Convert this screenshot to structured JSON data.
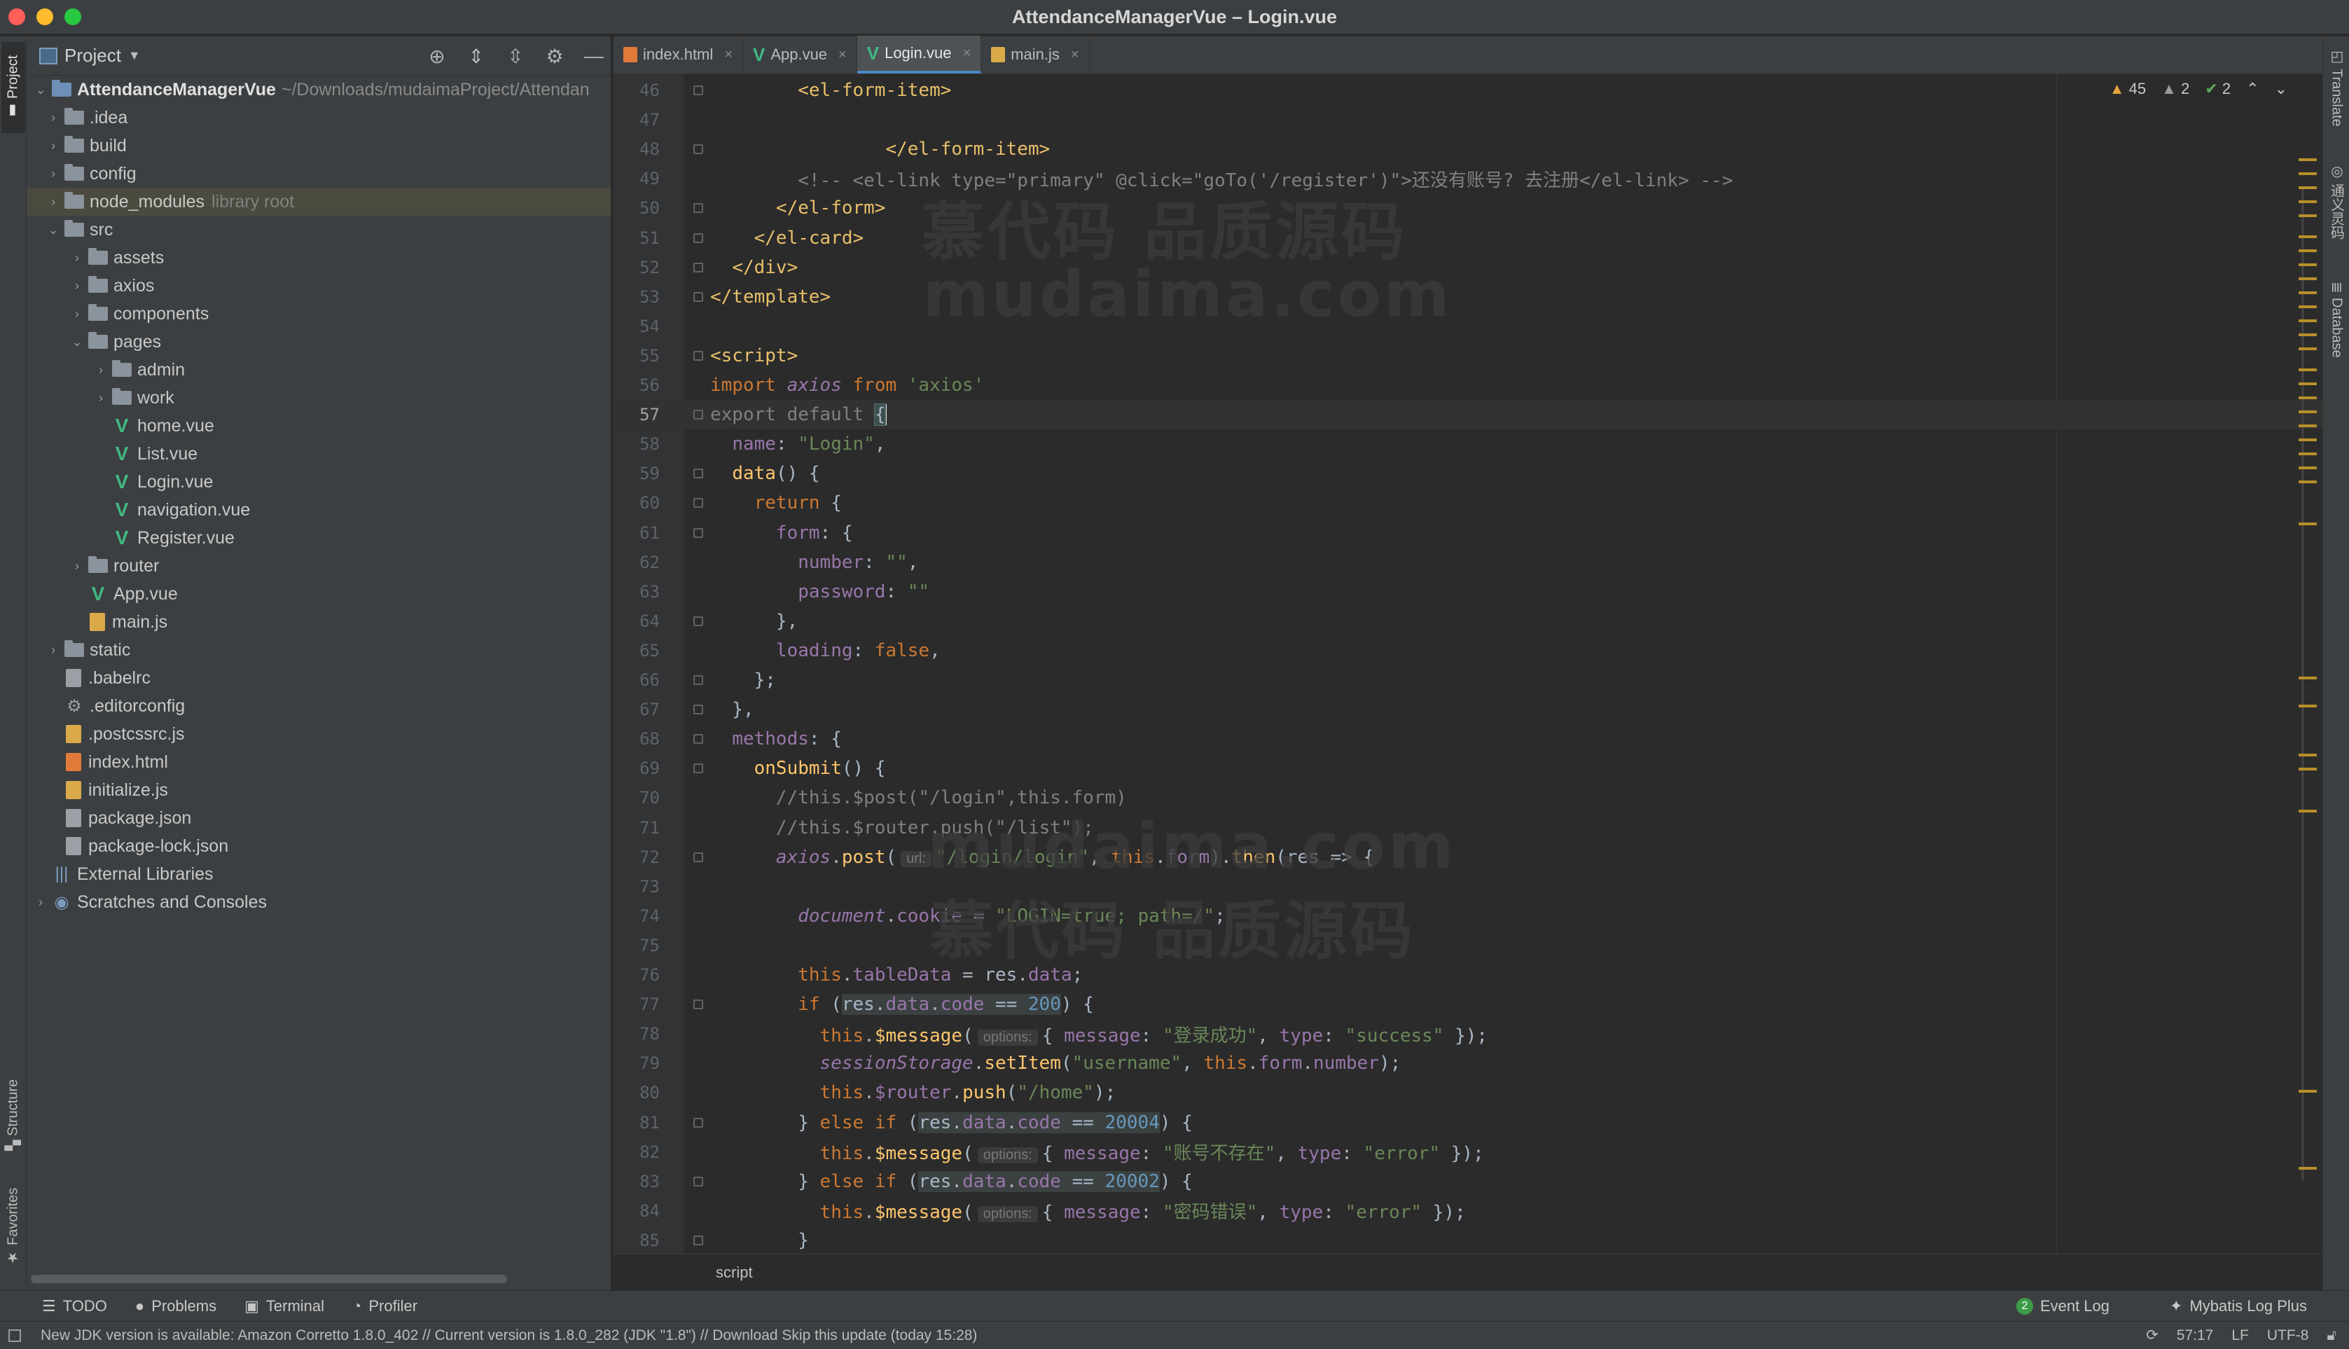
{
  "window": {
    "title": "AttendanceManagerVue – Login.vue",
    "traffic_colors": [
      "#ff5f57",
      "#febc2e",
      "#28c840"
    ]
  },
  "left_strip": {
    "project_label": "Project",
    "structure_label": "Structure",
    "favorites_label": "Favorites"
  },
  "right_strip": {
    "translate_label": "Translate",
    "second_label": "通义灵码",
    "database_label": "Database"
  },
  "project_panel": {
    "title": "Project",
    "root": {
      "name": "AttendanceManagerVue",
      "path": "~/Downloads/mudaimaProject/Attendan"
    },
    "items": [
      {
        "label": "idea",
        "prefix": ".",
        "type": "folder",
        "depth": 1,
        "expanded": false
      },
      {
        "label": "build",
        "type": "folder",
        "depth": 1,
        "expanded": false
      },
      {
        "label": "config",
        "type": "folder",
        "depth": 1,
        "expanded": false
      },
      {
        "label": "node_modules",
        "type": "folder",
        "depth": 1,
        "expanded": false,
        "note": "library root",
        "selected": true
      },
      {
        "label": "src",
        "type": "folder",
        "depth": 1,
        "expanded": true
      },
      {
        "label": "assets",
        "type": "folder",
        "depth": 2,
        "expanded": false
      },
      {
        "label": "axios",
        "type": "folder",
        "depth": 2,
        "expanded": false
      },
      {
        "label": "components",
        "type": "folder",
        "depth": 2,
        "expanded": false
      },
      {
        "label": "pages",
        "type": "folder",
        "depth": 2,
        "expanded": true
      },
      {
        "label": "admin",
        "type": "folder",
        "depth": 3,
        "expanded": false
      },
      {
        "label": "work",
        "type": "folder",
        "depth": 3,
        "expanded": false
      },
      {
        "label": "home.vue",
        "type": "vue",
        "depth": 3
      },
      {
        "label": "List.vue",
        "type": "vue",
        "depth": 3
      },
      {
        "label": "Login.vue",
        "type": "vue",
        "depth": 3
      },
      {
        "label": "navigation.vue",
        "type": "vue",
        "depth": 3
      },
      {
        "label": "Register.vue",
        "type": "vue",
        "depth": 3
      },
      {
        "label": "router",
        "type": "folder",
        "depth": 2,
        "expanded": false
      },
      {
        "label": "App.vue",
        "type": "vue",
        "depth": 2
      },
      {
        "label": "main.js",
        "type": "js",
        "depth": 2
      },
      {
        "label": "static",
        "type": "folder",
        "depth": 1,
        "expanded": false
      },
      {
        "label": ".babelrc",
        "type": "json",
        "depth": 1
      },
      {
        "label": ".editorconfig",
        "type": "gear",
        "depth": 1
      },
      {
        "label": ".postcssrc.js",
        "type": "js",
        "depth": 1
      },
      {
        "label": "index.html",
        "type": "html",
        "depth": 1
      },
      {
        "label": "initialize.js",
        "type": "js",
        "depth": 1
      },
      {
        "label": "package.json",
        "type": "json",
        "depth": 1
      },
      {
        "label": "package-lock.json",
        "type": "json",
        "depth": 1
      },
      {
        "label": "External Libraries",
        "type": "lib",
        "depth": 0
      },
      {
        "label": "Scratches and Consoles",
        "type": "scratch",
        "depth": 0,
        "expanded": false
      }
    ]
  },
  "tabs": [
    {
      "label": "index.html",
      "icon": "html",
      "active": false
    },
    {
      "label": "App.vue",
      "icon": "vue",
      "active": false
    },
    {
      "label": "Login.vue",
      "icon": "vue",
      "active": true
    },
    {
      "label": "main.js",
      "icon": "js",
      "active": false
    }
  ],
  "inspections": {
    "warnings": "45",
    "weak_warnings": "2",
    "ok": "2"
  },
  "editor": {
    "current_line": 57,
    "hints": {
      "url": "url:",
      "options": "options:"
    }
  },
  "watermarks": [
    "慕代码 品质源码",
    "mudaima.com",
    "mudaima.com",
    "慕代码 品质源码"
  ],
  "breadcrumb": "script",
  "toolwindows": {
    "todo": "TODO",
    "problems": "Problems",
    "terminal": "Terminal",
    "profiler": "Profiler",
    "event_log": "Event Log",
    "event_count": "2",
    "mybatis": "Mybatis Log Plus"
  },
  "status": {
    "message": "New JDK version is available: Amazon Corretto 1.8.0_402 // Current version is 1.8.0_282 (JDK \"1.8\") // Download   Skip this update (today 15:28)",
    "position": "57:17",
    "line_sep": "LF",
    "encoding": "UTF-8"
  }
}
